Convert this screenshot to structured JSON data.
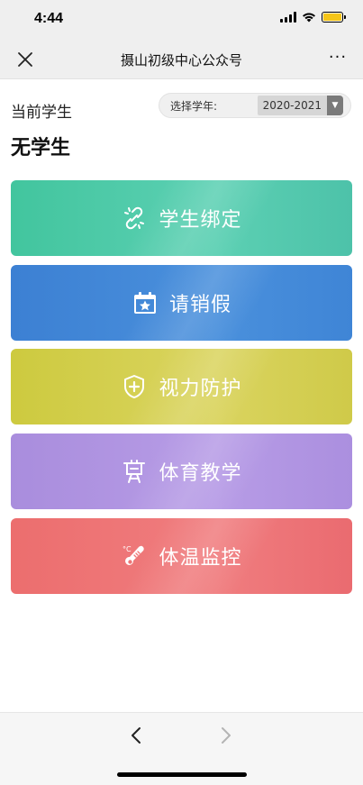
{
  "status": {
    "time": "4:44"
  },
  "nav": {
    "title": "摄山初级中心公众号",
    "more": "···"
  },
  "header": {
    "current_label": "当前学生",
    "student_name": "无学生",
    "year_label": "选择学年:",
    "year_value": "2020-2021"
  },
  "menu": {
    "items": [
      {
        "label": "学生绑定",
        "icon": "link-icon",
        "color": "#4ec8a8"
      },
      {
        "label": "请销假",
        "icon": "calendar-star-icon",
        "color": "#4389d8"
      },
      {
        "label": "视力防护",
        "icon": "shield-plus-icon",
        "color": "#d5cf4f"
      },
      {
        "label": "体育教学",
        "icon": "board-icon",
        "color": "#b095e2"
      },
      {
        "label": "体温监控",
        "icon": "thermometer-icon",
        "color": "#ee7576"
      }
    ]
  },
  "toolbar": {
    "back": "back-arrow-icon",
    "forward": "forward-arrow-icon"
  }
}
